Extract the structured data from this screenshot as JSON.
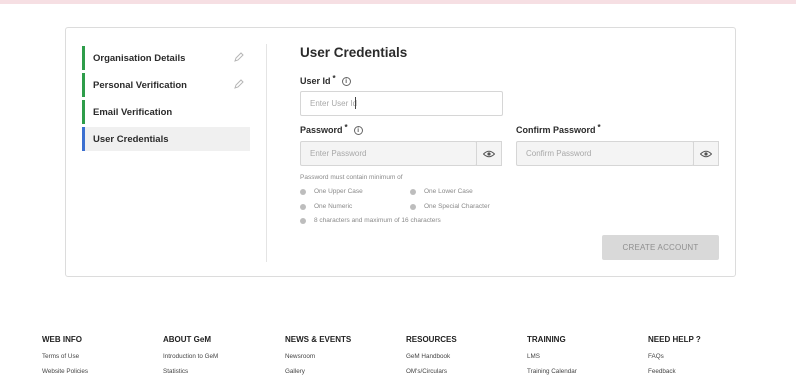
{
  "steps": [
    {
      "label": "Organisation Details",
      "completed": true
    },
    {
      "label": "Personal Verification",
      "completed": true
    },
    {
      "label": "Email Verification",
      "completed": true
    },
    {
      "label": "User Credentials",
      "active": true
    }
  ],
  "form": {
    "title": "User Credentials",
    "user_id": {
      "label": "User Id",
      "required": "*",
      "placeholder": "Enter User Id",
      "value": ""
    },
    "password": {
      "label": "Password",
      "required": "*",
      "placeholder": "Enter Password",
      "value": ""
    },
    "confirm_password": {
      "label": "Confirm Password",
      "required": "*",
      "placeholder": "Confirm Password",
      "value": ""
    },
    "rules_title": "Password must contain minimum of",
    "rules": [
      "One Upper Case",
      "One Lower Case",
      "One Numeric",
      "One Special Character",
      "8 characters and maximum of 16 characters"
    ],
    "create_button": "CREATE ACCOUNT"
  },
  "footer": {
    "columns": [
      {
        "heading": "WEB INFO",
        "links": [
          "Terms of Use",
          "Website Policies"
        ]
      },
      {
        "heading": "ABOUT GeM",
        "links": [
          "Introduction to GeM",
          "Statistics"
        ]
      },
      {
        "heading": "NEWS & EVENTS",
        "links": [
          "Newsroom",
          "Gallery"
        ]
      },
      {
        "heading": "RESOURCES",
        "links": [
          "GeM Handbook",
          "OM's/Circulars"
        ]
      },
      {
        "heading": "TRAINING",
        "links": [
          "LMS",
          "Training Calendar"
        ]
      },
      {
        "heading": "NEED HELP ?",
        "links": [
          "FAQs",
          "Feedback"
        ]
      }
    ]
  },
  "colors": {
    "completed_bar": "#2e9d4a",
    "active_bar": "#3b6fd0",
    "button_disabled": "#d9d9d9"
  }
}
